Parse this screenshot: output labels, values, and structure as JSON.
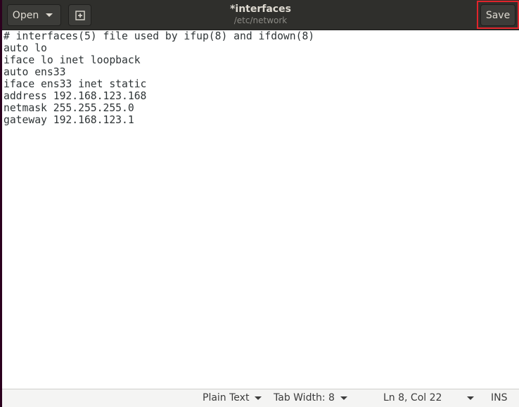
{
  "header": {
    "open_label": "Open",
    "title": "*interfaces",
    "subtitle": "/etc/network",
    "save_label": "Save",
    "highlight_color": "#e0242b"
  },
  "editor": {
    "lines": [
      "# interfaces(5) file used by ifup(8) and ifdown(8)",
      "auto lo",
      "iface lo inet loopback",
      "auto ens33",
      "iface ens33 inet static",
      "address 192.168.123.168",
      "netmask 255.255.255.0",
      "gateway 192.168.123.1"
    ]
  },
  "statusbar": {
    "language": "Plain Text",
    "tab_width": "Tab Width: 8",
    "cursor": "Ln 8, Col 22",
    "mode": "INS"
  }
}
